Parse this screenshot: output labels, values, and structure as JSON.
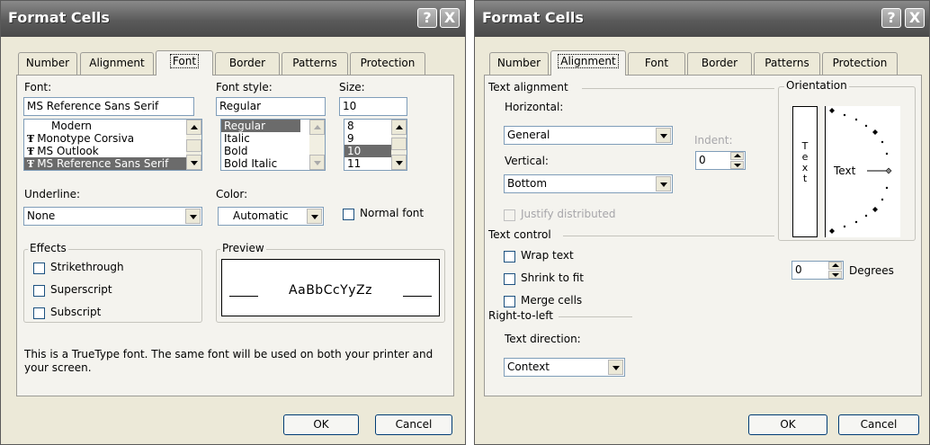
{
  "font_dialog": {
    "title": "Format Cells",
    "help_button": "?",
    "close_button": "X",
    "tabs": [
      {
        "label": "Number"
      },
      {
        "label": "Alignment"
      },
      {
        "label": "Font"
      },
      {
        "label": "Border"
      },
      {
        "label": "Patterns"
      },
      {
        "label": "Protection"
      }
    ],
    "active_tab": "Font",
    "font_label": "Font:",
    "font_value": "MS Reference Sans Serif",
    "font_list": [
      {
        "label": "Modern",
        "icon": "none"
      },
      {
        "label": "Monotype Corsiva",
        "icon": "truetype-icon"
      },
      {
        "label": "MS Outlook",
        "icon": "truetype-icon"
      },
      {
        "label": "MS Reference Sans Serif",
        "icon": "truetype-icon",
        "selected": true
      }
    ],
    "style_label": "Font style:",
    "style_value": "Regular",
    "style_list": [
      {
        "label": "Regular",
        "selected": true
      },
      {
        "label": "Italic"
      },
      {
        "label": "Bold"
      },
      {
        "label": "Bold Italic"
      }
    ],
    "size_label": "Size:",
    "size_value": "10",
    "size_list": [
      {
        "label": "8"
      },
      {
        "label": "9"
      },
      {
        "label": "10",
        "selected": true
      },
      {
        "label": "11"
      }
    ],
    "underline_label": "Underline:",
    "underline_value": "None",
    "color_label": "Color:",
    "color_value": "Automatic",
    "normal_font_label": "Normal font",
    "effects_label": "Effects",
    "effects": [
      {
        "label": "Strikethrough",
        "checked": false
      },
      {
        "label": "Superscript",
        "checked": false
      },
      {
        "label": "Subscript",
        "checked": false
      }
    ],
    "preview_label": "Preview",
    "preview_text": "AaBbCcYyZz",
    "info_text": "This is a TrueType font.  The same font will be used on both your printer and your screen.",
    "ok_label": "OK",
    "cancel_label": "Cancel"
  },
  "align_dialog": {
    "title": "Format Cells",
    "help_button": "?",
    "close_button": "X",
    "tabs": [
      {
        "label": "Number"
      },
      {
        "label": "Alignment"
      },
      {
        "label": "Font"
      },
      {
        "label": "Border"
      },
      {
        "label": "Patterns"
      },
      {
        "label": "Protection"
      }
    ],
    "active_tab": "Alignment",
    "text_alignment_label": "Text alignment",
    "horizontal_label": "Horizontal:",
    "horizontal_value": "General",
    "indent_label": "Indent:",
    "indent_value": "0",
    "vertical_label": "Vertical:",
    "vertical_value": "Bottom",
    "justify_distributed_label": "Justify distributed",
    "text_control_label": "Text control",
    "wrap_text_label": "Wrap text",
    "shrink_label": "Shrink to fit",
    "merge_label": "Merge cells",
    "rtl_label": "Right-to-left",
    "text_direction_label": "Text direction:",
    "text_direction_value": "Context",
    "orientation_label": "Orientation",
    "orientation_vertical_letters": [
      "T",
      "e",
      "x",
      "t"
    ],
    "orientation_text": "Text",
    "degrees_value": "0",
    "degrees_label": "Degrees",
    "ok_label": "OK",
    "cancel_label": "Cancel"
  },
  "colors": {
    "dialog_bg": "#ece9d8",
    "panel_bg": "#f4f3ee",
    "titlebar": "#5a5a5a",
    "selection": "#6b6b6b"
  }
}
